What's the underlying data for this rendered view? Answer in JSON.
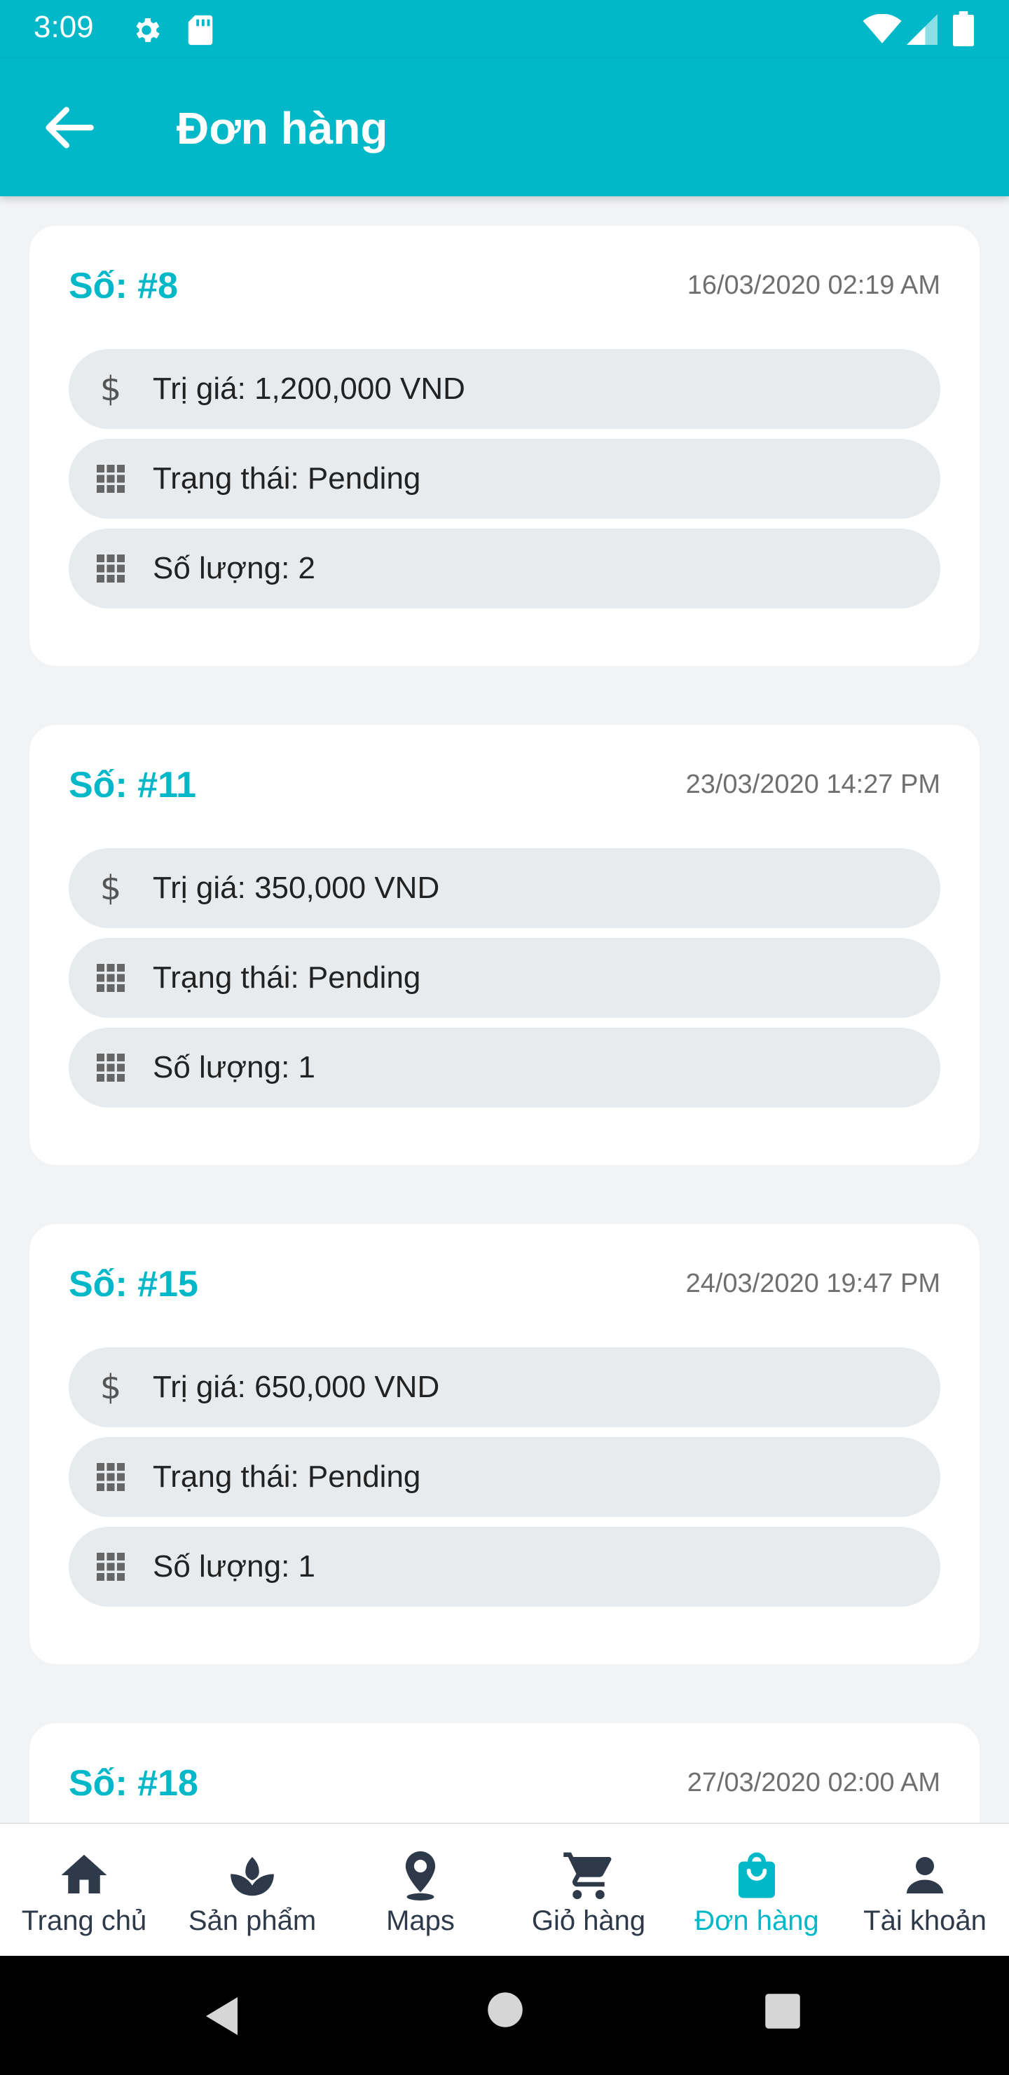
{
  "status_bar": {
    "time": "3:09"
  },
  "app_bar": {
    "title": "Đơn hàng"
  },
  "orders": [
    {
      "number": "Số: #8",
      "date": "16/03/2020 02:19 AM",
      "value": "Trị giá: 1,200,000 VND",
      "status": "Trạng thái: Pending",
      "quantity": "Số lượng: 2"
    },
    {
      "number": "Số: #11",
      "date": "23/03/2020 14:27 PM",
      "value": "Trị giá: 350,000 VND",
      "status": "Trạng thái: Pending",
      "quantity": "Số lượng: 1"
    },
    {
      "number": "Số: #15",
      "date": "24/03/2020 19:47 PM",
      "value": "Trị giá: 650,000 VND",
      "status": "Trạng thái: Pending",
      "quantity": "Số lượng: 1"
    },
    {
      "number": "Số: #18",
      "date": "27/03/2020 02:00 AM"
    }
  ],
  "bottom_nav": {
    "active": "Đơn hàng",
    "active_color": "#00b8c7",
    "items": [
      {
        "label": "Trang chủ",
        "icon": "home-icon"
      },
      {
        "label": "Sản phẩm",
        "icon": "plant-icon"
      },
      {
        "label": "Maps",
        "icon": "map-pin-icon"
      },
      {
        "label": "Giỏ hàng",
        "icon": "cart-icon"
      },
      {
        "label": "Đơn hàng",
        "icon": "shopping-bag-icon"
      },
      {
        "label": "Tài khoản",
        "icon": "person-icon"
      }
    ]
  },
  "theme": {
    "primary": "#00b8c7",
    "pill_bg": "#e8ebed"
  }
}
